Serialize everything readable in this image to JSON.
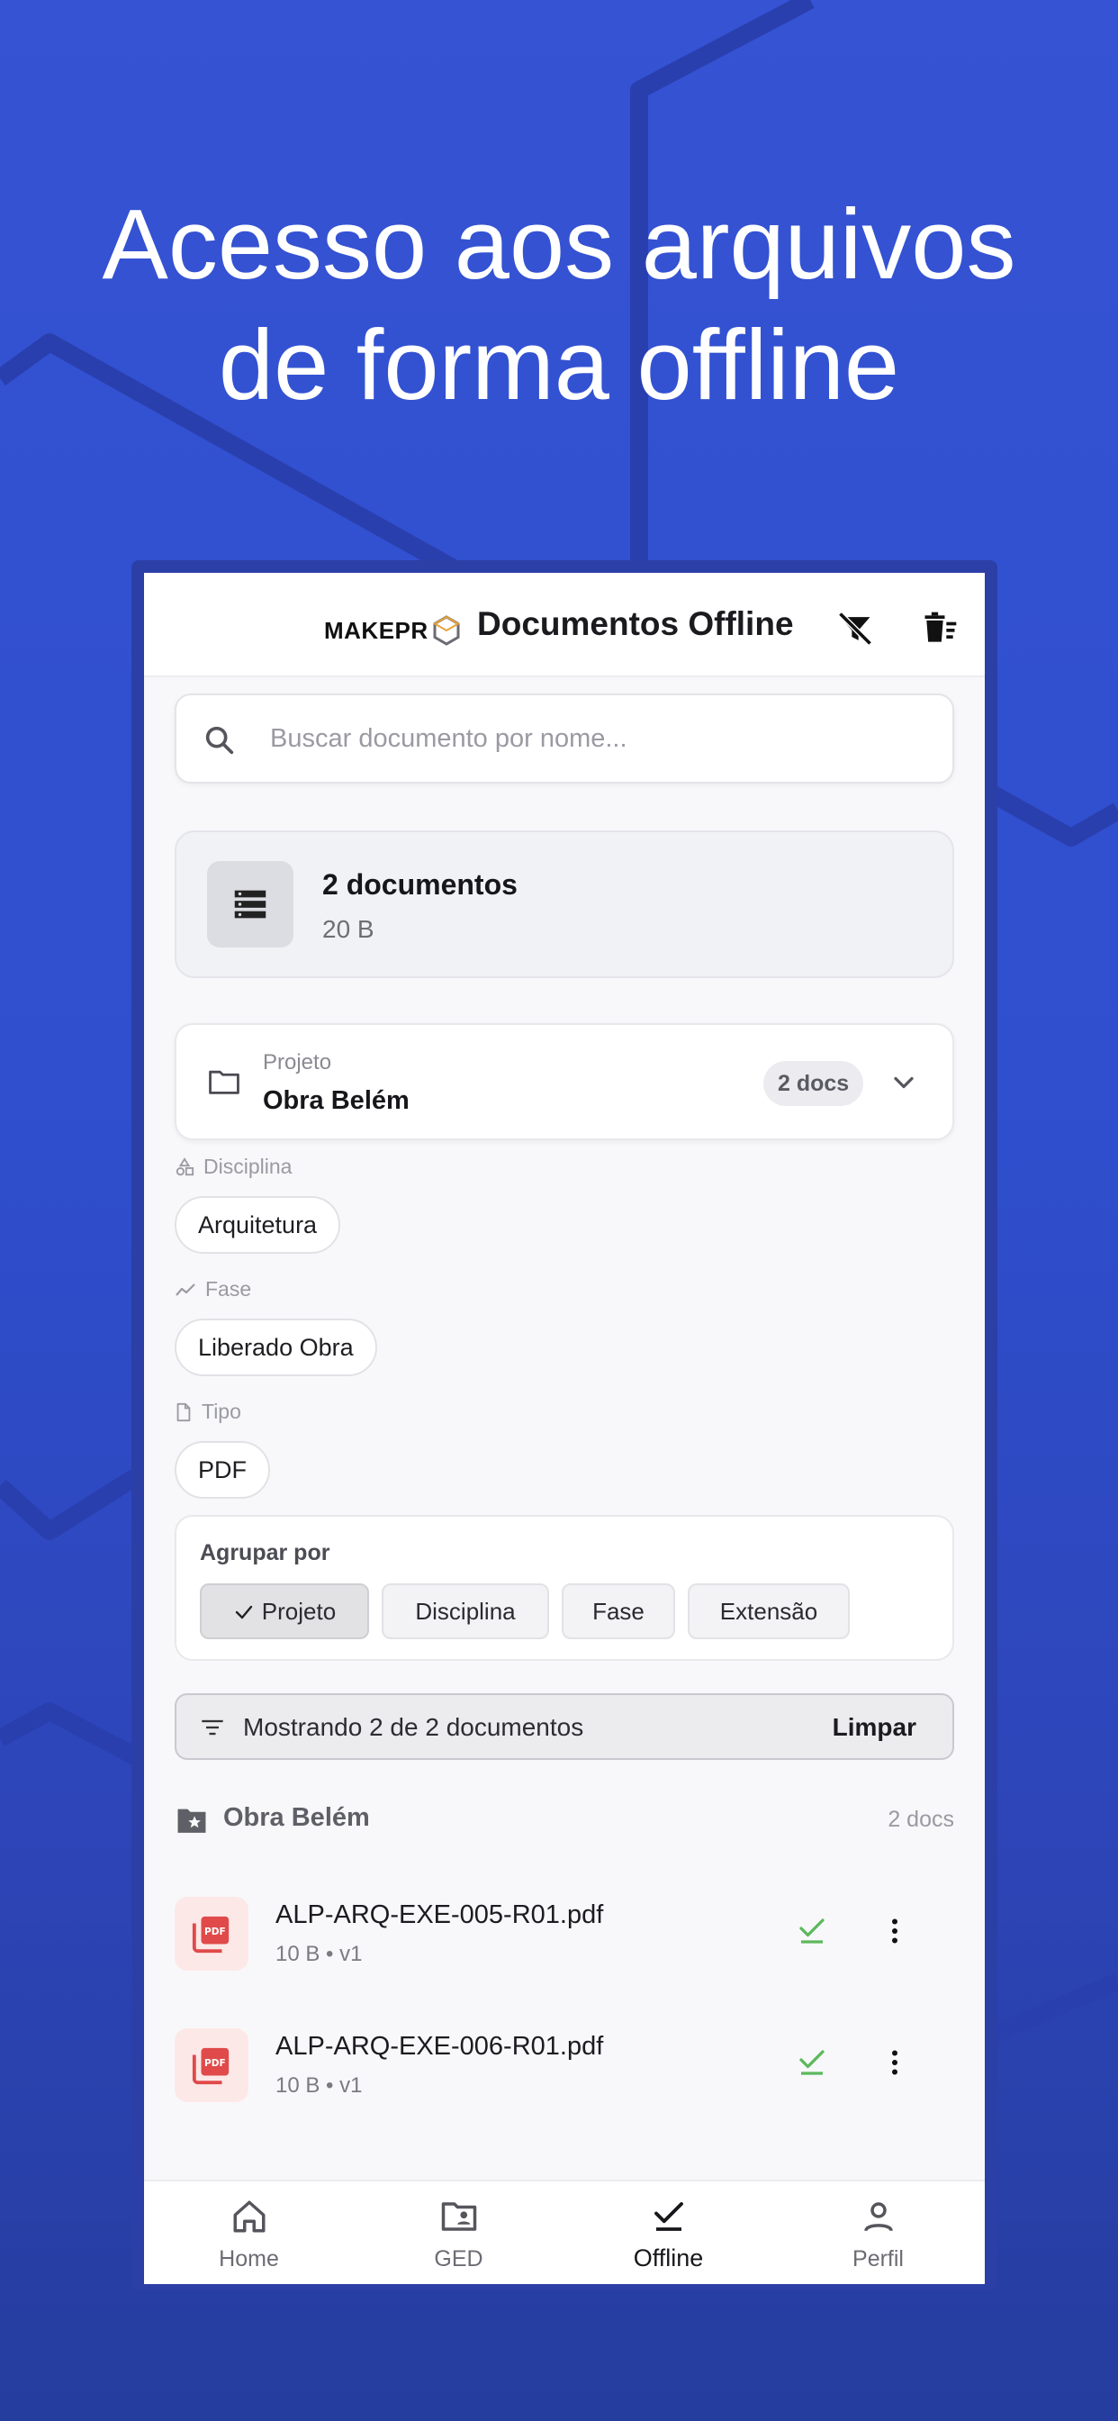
{
  "headline": {
    "line1": "Acesso aos arquivos",
    "line2": "de forma offline"
  },
  "appbar": {
    "logo_text": "MAKEPR",
    "title": "Documentos Offline",
    "icons": [
      "filter-off-icon",
      "delete-sweep-icon"
    ]
  },
  "search": {
    "placeholder": "Buscar documento por nome..."
  },
  "summary": {
    "count": "2 documentos",
    "size": "20 B"
  },
  "project": {
    "label": "Projeto",
    "value": "Obra Belém",
    "badge": "2 docs"
  },
  "filters": {
    "disciplina": {
      "label": "Disciplina",
      "chip": "Arquitetura"
    },
    "fase": {
      "label": "Fase",
      "chip": "Liberado Obra"
    },
    "tipo": {
      "label": "Tipo",
      "chip": "PDF"
    }
  },
  "groupby": {
    "title": "Agrupar por",
    "options": [
      "Projeto",
      "Disciplina",
      "Fase",
      "Extensão"
    ],
    "selected": "Projeto"
  },
  "results": {
    "text": "Mostrando 2 de 2 documentos",
    "clear": "Limpar"
  },
  "group": {
    "title": "Obra Belém",
    "count": "2 docs"
  },
  "files": [
    {
      "name": "ALP-ARQ-EXE-005-R01.pdf",
      "meta": "10 B • v1"
    },
    {
      "name": "ALP-ARQ-EXE-006-R01.pdf",
      "meta": "10 B • v1"
    }
  ],
  "nav": [
    {
      "label": "Home",
      "icon": "home-icon"
    },
    {
      "label": "GED",
      "icon": "folder-account-icon"
    },
    {
      "label": "Offline",
      "icon": "check-underline-icon",
      "active": true
    },
    {
      "label": "Perfil",
      "icon": "person-icon"
    }
  ],
  "colors": {
    "background": "#3553d3",
    "accent_green": "#5cb85c",
    "pdf_red": "#e04a4a"
  }
}
